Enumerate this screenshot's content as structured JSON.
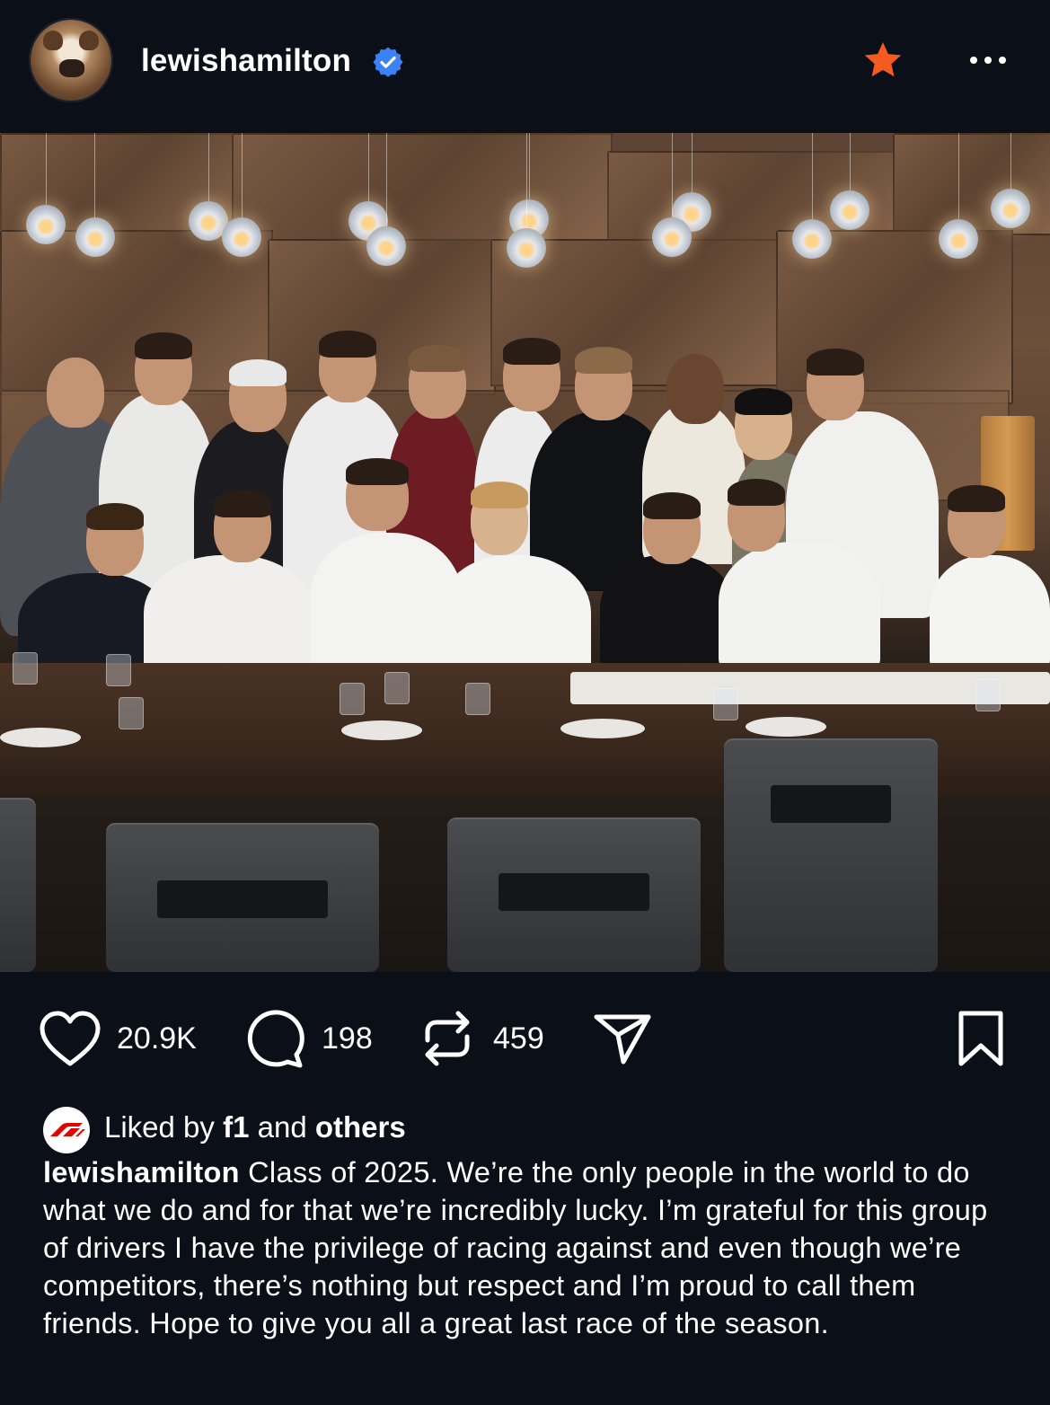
{
  "post": {
    "username": "lewishamilton",
    "verified_icon": "verified-badge-icon",
    "favorite_icon": "star-icon",
    "more_icon": "more-options-icon",
    "colors": {
      "background": "#0b0f18",
      "verified": "#3b82f6",
      "favorite_star": "#f55a1f"
    }
  },
  "actions": {
    "likes": "20.9K",
    "comments": "198",
    "reposts": "459",
    "icons": [
      "heart-icon",
      "comment-icon",
      "repost-icon",
      "share-icon",
      "bookmark-icon"
    ]
  },
  "liked_by": {
    "prefix": "Liked by",
    "user": "f1",
    "connector": "and",
    "suffix": "others"
  },
  "caption": {
    "username": "lewishamilton",
    "text": "Class of 2025. We’re the only people in the world to do what we do and for that we’re incredibly lucky. I’m grateful for this group of drivers I have the privilege of racing against and even though we’re competitors, there’s nothing but respect and I’m proud to call them friends. Hope to give you all a great last race of the season."
  }
}
